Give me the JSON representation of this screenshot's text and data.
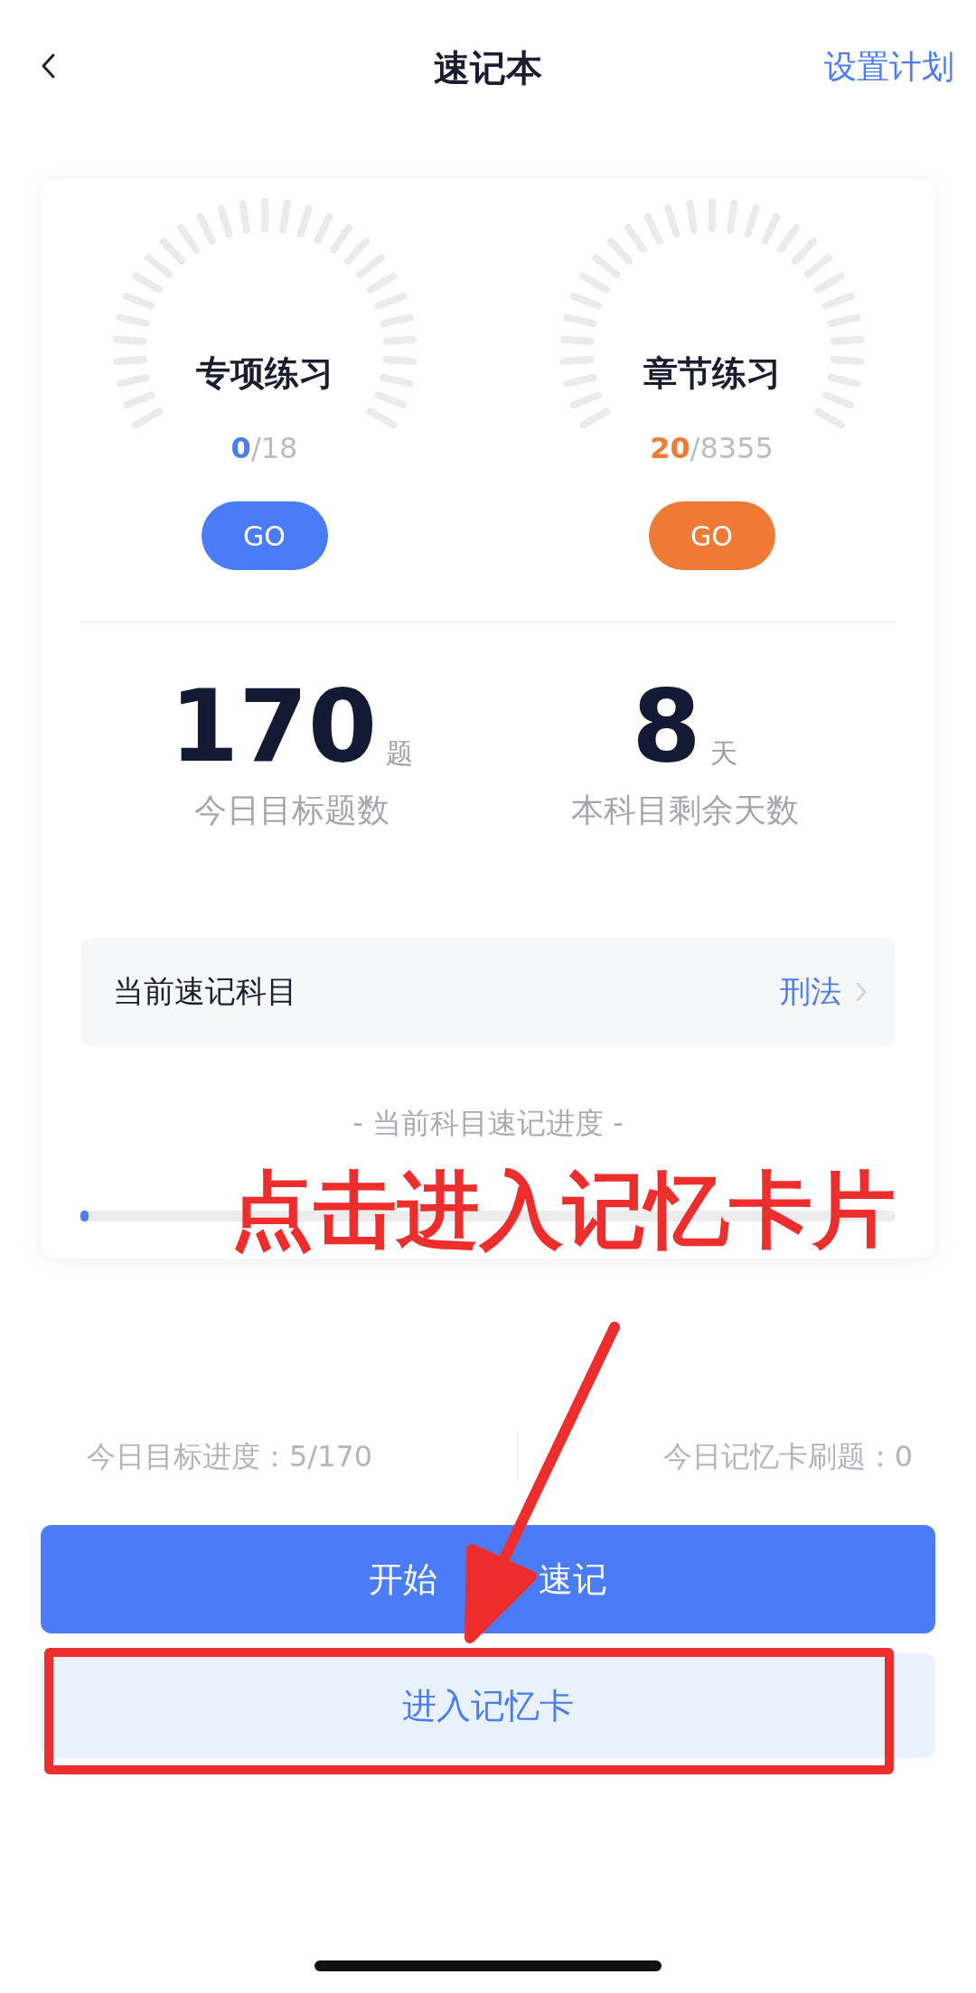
{
  "header": {
    "title": "速记本",
    "action": "设置计划"
  },
  "practice": [
    {
      "title": "专项练习",
      "done": "0",
      "total": "/18",
      "button": "GO",
      "color": "#4a7cf7"
    },
    {
      "title": "章节练习",
      "done": "20",
      "total": "/8355",
      "button": "GO",
      "color": "#ee7a35"
    }
  ],
  "stats": [
    {
      "value": "170",
      "unit": "题",
      "label": "今日目标题数"
    },
    {
      "value": "8",
      "unit": "天",
      "label": "本科目剩余天数"
    }
  ],
  "subject": {
    "label": "当前速记科目",
    "value": "刑法"
  },
  "progress": {
    "title": "- 当前科目速记进度 -",
    "level": 0.01
  },
  "summary": [
    "今日目标进度：5/170",
    "今日记忆卡刷题：0"
  ],
  "buttons": [
    {
      "kind": "primary",
      "label": "开始 速记"
    },
    {
      "kind": "secondary",
      "label": "进入记忆卡"
    }
  ],
  "annotation": {
    "callout": "点击进入记忆卡片"
  }
}
